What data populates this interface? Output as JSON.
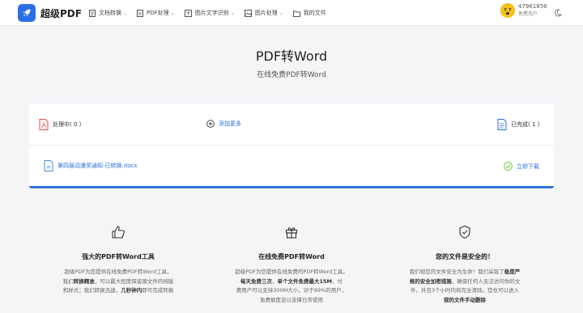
{
  "header": {
    "logo_text": "超级PDF",
    "nav": [
      {
        "label": "文档转换",
        "icon": "document-convert-icon",
        "has_dropdown": true
      },
      {
        "label": "PDF处理",
        "icon": "pdf-process-icon",
        "has_dropdown": true
      },
      {
        "label": "图片文字识别",
        "icon": "ocr-icon",
        "has_dropdown": true
      },
      {
        "label": "图片处理",
        "icon": "image-process-icon",
        "has_dropdown": true
      },
      {
        "label": "我的文件",
        "icon": "my-files-icon",
        "has_dropdown": false
      }
    ],
    "user_id": "47961856",
    "user_type": "免费用户"
  },
  "hero": {
    "title": "PDF转Word",
    "subtitle": "在线免费PDF转Word"
  },
  "card": {
    "processing_label": "处理中( 0 )",
    "add_more_label": "添加更多",
    "completed_label": "已完成( 1 )",
    "file_name": "第四届动漫奖通知-已转换.docx",
    "download_label": "立即下载",
    "progress": 1.0
  },
  "features": [
    {
      "icon": "thumbs-up-icon",
      "title": "强大的PDF转Word工具",
      "desc_lines": [
        [
          {
            "t": "超级PDF为您提供在线免费PDF转Word工具，"
          }
        ],
        [
          {
            "t": "我们"
          },
          {
            "t": "转换精准",
            "b": true
          },
          {
            "t": "，可以最大程度保留源文件的排版"
          }
        ],
        [
          {
            "t": "和样式；我们转换迅速，"
          },
          {
            "t": "几秒钟内",
            "b": true
          },
          {
            "t": "即可完成转换"
          }
        ]
      ]
    },
    {
      "icon": "gift-icon",
      "title": "在线免费PDF转Word",
      "desc_lines": [
        [
          {
            "t": "超级PDF为您提供在线免费的PDF转Word工具，"
          }
        ],
        [
          {
            "t": "每天免费三次",
            "b": true
          },
          {
            "t": "，"
          },
          {
            "t": "单个文件免费最大15M",
            "b": true
          },
          {
            "t": "，付"
          }
        ],
        [
          {
            "t": "费用户可以支持300M大小，对于99%的用户，"
          }
        ],
        [
          {
            "t": "免费额度足以支撑日常使用"
          }
        ]
      ]
    },
    {
      "icon": "shield-check-icon",
      "title": "您的文件是安全的！",
      "desc_lines": [
        [
          {
            "t": "我们视您的文件安全为生命！我们采取了"
          },
          {
            "t": "极度严",
            "b": true
          }
        ],
        [
          {
            "t": "格的安全加密措施",
            "b": true
          },
          {
            "t": "，确保任何人无法访问你的文"
          }
        ],
        [
          {
            "t": "件，并且3个小时内将完全清除。您也可以进入"
          }
        ],
        [
          {
            "t": "我的文件手动删除",
            "b": true
          }
        ]
      ]
    }
  ],
  "colors": {
    "accent": "#2a6ee8",
    "pdf_red": "#e94b3c",
    "success_green": "#52c41a",
    "background": "#f4f5f7"
  }
}
